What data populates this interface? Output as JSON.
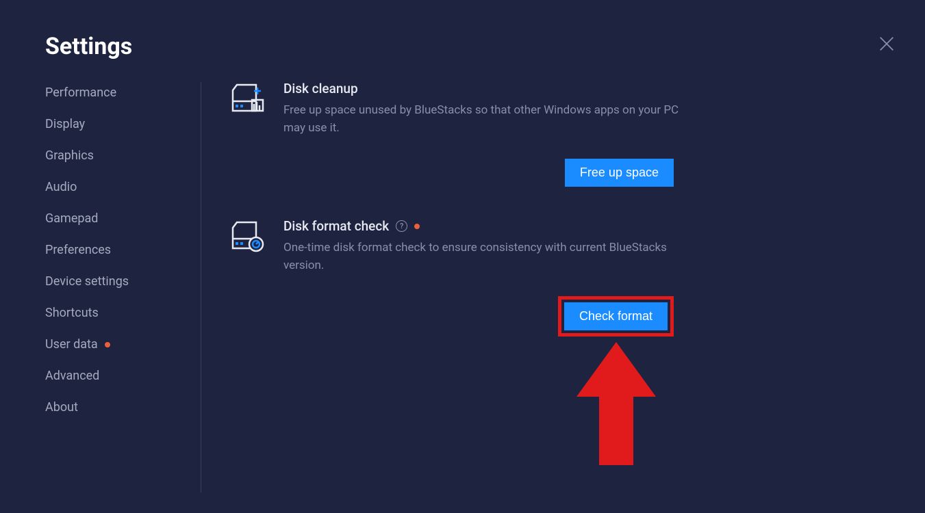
{
  "title": "Settings",
  "sidebar": {
    "items": [
      {
        "label": "Performance",
        "has_dot": false
      },
      {
        "label": "Display",
        "has_dot": false
      },
      {
        "label": "Graphics",
        "has_dot": false
      },
      {
        "label": "Audio",
        "has_dot": false
      },
      {
        "label": "Gamepad",
        "has_dot": false
      },
      {
        "label": "Preferences",
        "has_dot": false
      },
      {
        "label": "Device settings",
        "has_dot": false
      },
      {
        "label": "Shortcuts",
        "has_dot": false
      },
      {
        "label": "User data",
        "has_dot": true
      },
      {
        "label": "Advanced",
        "has_dot": false
      },
      {
        "label": "About",
        "has_dot": false
      }
    ]
  },
  "sections": {
    "disk_cleanup": {
      "title": "Disk cleanup",
      "description": "Free up space unused by BlueStacks so that other Windows apps on your PC may use it.",
      "button": "Free up space"
    },
    "disk_format_check": {
      "title": "Disk format check",
      "description": "One-time disk format check to ensure consistency with current BlueStacks version.",
      "button": "Check format",
      "has_help": true,
      "has_dot": true
    }
  },
  "colors": {
    "accent": "#1a8cff",
    "bg": "#1e2340",
    "annotation": "#e11b1b",
    "dot": "#ec5f3b"
  }
}
